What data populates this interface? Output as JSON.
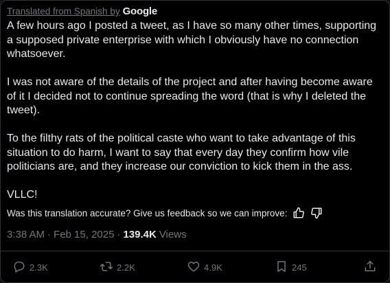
{
  "header": {
    "translated_label": "Translated from Spanish by",
    "google_logo": "Google"
  },
  "body": {
    "paragraphs": [
      "A few hours ago I posted a tweet, as I have so many other times, supporting a supposed private enterprise with which I obviously have no connection whatsoever.",
      "I was not aware of the details of the project and after having become aware of it I decided not to continue spreading the word (that is why I deleted the tweet).",
      "To the filthy rats of the political caste who want to take advantage of this situation to do harm, I want to say that every day they confirm how vile politicians are, and they increase our conviction to kick them in the ass.",
      "VLLC!"
    ]
  },
  "feedback": {
    "question": "Was this translation accurate? Give us feedback so we can improve:",
    "thumbs_up_icon": "thumbs-up-icon",
    "thumbs_down_icon": "thumbs-down-icon"
  },
  "meta": {
    "time": "3:38 AM",
    "separator": "·",
    "date": "Feb 15, 2025",
    "views_count": "139.4K",
    "views_label": "Views"
  },
  "actions": {
    "reply_count": "2.3K",
    "repost_count": "2.2K",
    "like_count": "4.9K",
    "bookmark_count": "245"
  },
  "colors": {
    "background": "#000000",
    "text": "#e7e9ea",
    "muted": "#71767b",
    "border": "#2f3336"
  }
}
